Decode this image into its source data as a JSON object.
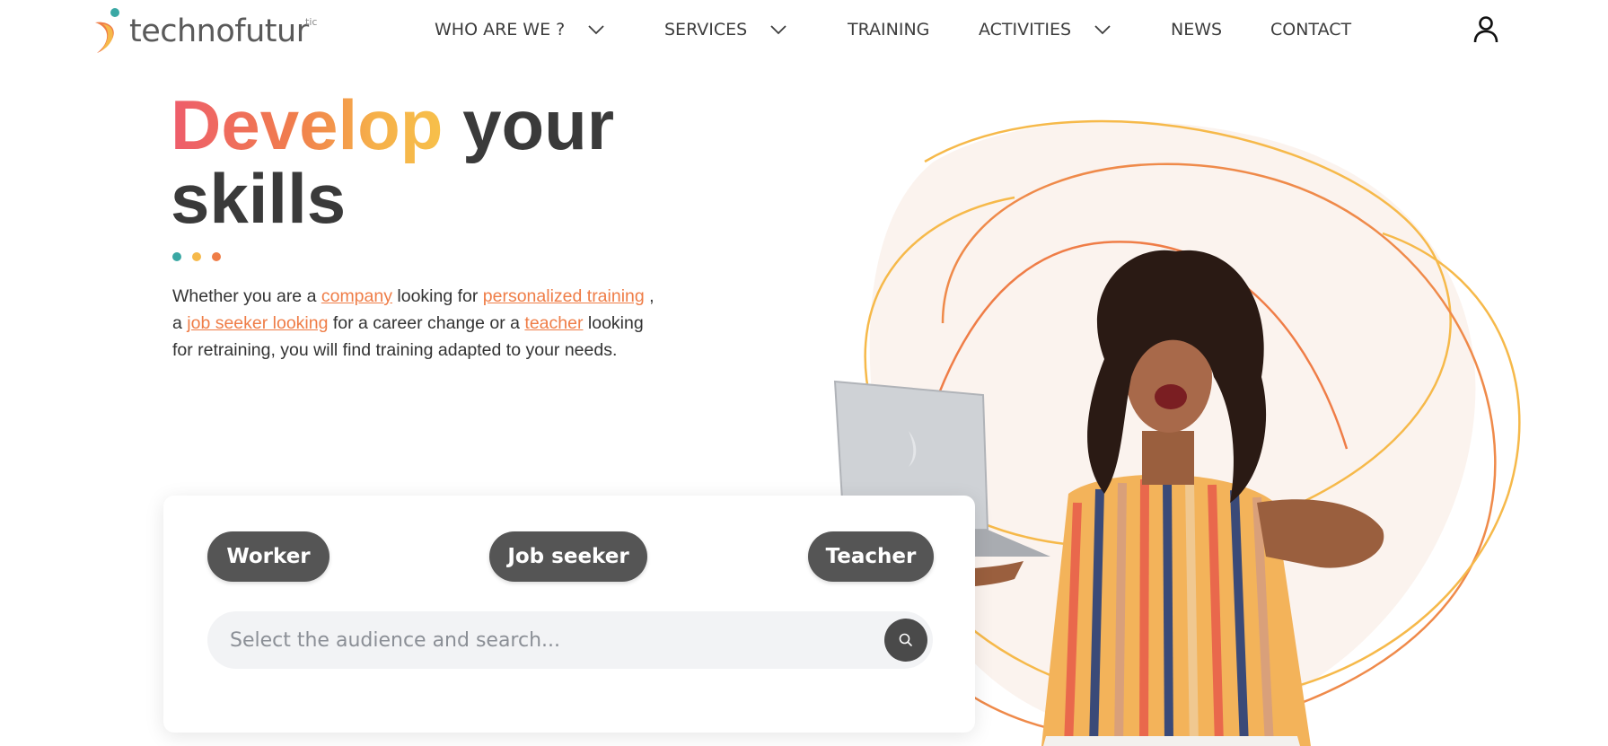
{
  "brand": {
    "name": "technofutur",
    "superscript": "tic",
    "colors": {
      "teal": "#3aa8a4",
      "orange": "#ef7d47",
      "yellow": "#f6b94a",
      "pink": "#ee5d6c",
      "dark": "#3a3a3a"
    }
  },
  "nav": {
    "items": [
      {
        "label": "WHO ARE WE ?",
        "has_dropdown": true
      },
      {
        "label": "SERVICES",
        "has_dropdown": true
      },
      {
        "label": "TRAINING",
        "has_dropdown": false
      },
      {
        "label": "ACTIVITIES",
        "has_dropdown": true
      },
      {
        "label": "NEWS",
        "has_dropdown": false
      },
      {
        "label": "CONTACT",
        "has_dropdown": false
      }
    ],
    "user_icon": "user-icon"
  },
  "hero": {
    "title_highlight": "Develop",
    "title_rest_1": "your",
    "title_rest_2": "skills",
    "intro": {
      "t1": "Whether you are a ",
      "link_company": "company",
      "t2": " looking for ",
      "link_personalized": "personalized training",
      "t3": " , a ",
      "link_job_seeker": "job seeker looking",
      "t4": " for a career change or a ",
      "link_teacher": "teacher",
      "t5": " looking for retraining, you will find training adapted to your needs."
    }
  },
  "search": {
    "audiences": [
      "Worker",
      "Job seeker",
      "Teacher"
    ],
    "placeholder": "Select the audience and search...",
    "value": "",
    "button_icon": "search-icon"
  }
}
